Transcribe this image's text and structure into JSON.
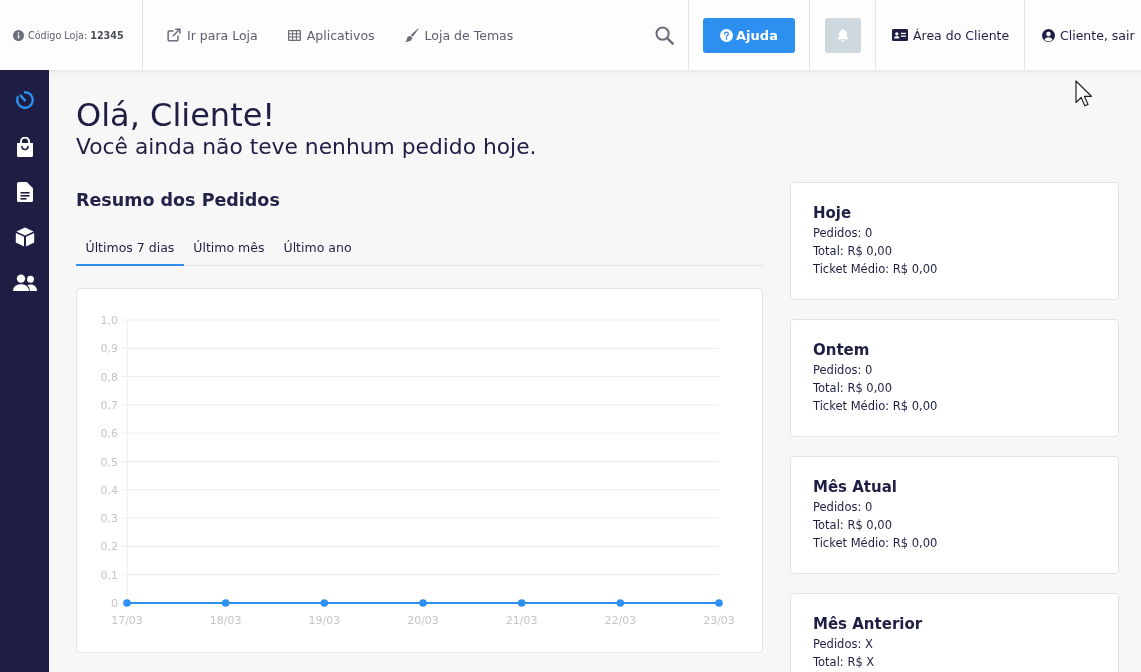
{
  "top_bar": {
    "store_code": "Código Loja: **12345**",
    "links": [
      {
        "label": "Ir para Loja"
      },
      {
        "label": "Aplicativos"
      },
      {
        "label": "Loja de Temas"
      }
    ],
    "help_button": "Ajuda",
    "client_area": "Área do Cliente",
    "logout": "Cliente, sair"
  },
  "sidebar": {
    "items": [
      {
        "selected": true
      },
      {
        "selected": false
      },
      {
        "selected": false
      },
      {
        "selected": false
      },
      {
        "selected": false
      }
    ]
  },
  "greeting": {
    "title": "Olá, Cliente!",
    "subtitle": "Você ainda não teve nenhum pedido hoje."
  },
  "orders_summary": {
    "title": "Resumo dos Pedidos",
    "tabs": [
      {
        "label": "Últimos 7 dias",
        "selected": true
      },
      {
        "label": "Último mês",
        "selected": false
      },
      {
        "label": "Último ano",
        "selected": false
      }
    ],
    "chart_data": {
      "type": "line",
      "grid": true,
      "categories": [
        "17/03",
        "18/03",
        "19/03",
        "20/03",
        "21/03",
        "22/03",
        "23/03"
      ],
      "series": [
        {
          "color": "#2d8ff0",
          "marker": true,
          "values": [
            0,
            0,
            0,
            0,
            0,
            0,
            0
          ]
        }
      ],
      "ylim": [
        0,
        1
      ],
      "yticks": [
        {
          "value": 0,
          "label": "0"
        },
        {
          "value": 0.1,
          "label": "0,1"
        },
        {
          "value": 0.2,
          "label": "0,2"
        },
        {
          "value": 0.3,
          "label": "0,3"
        },
        {
          "value": 0.4,
          "label": "0,4"
        },
        {
          "value": 0.5,
          "label": "0,5"
        },
        {
          "value": 0.6,
          "label": "0,6"
        },
        {
          "value": 0.7,
          "label": "0,7"
        },
        {
          "value": 0.8,
          "label": "0,8"
        },
        {
          "value": 0.9,
          "label": "0,9"
        },
        {
          "value": 1,
          "label": "1,0"
        }
      ]
    }
  },
  "period_cards": [
    {
      "title": "Hoje",
      "lines": [
        "Pedidos: 0",
        "Total: R$ 0,00",
        "Ticket Médio: R$ 0,00"
      ]
    },
    {
      "title": "Ontem",
      "lines": [
        "Pedidos: 0",
        "Total: R$ 0,00",
        "Ticket Médio: R$ 0,00"
      ]
    },
    {
      "title": "Mês Atual",
      "lines": [
        "Pedidos: 0",
        "Total: R$ 0,00",
        "Ticket Médio: R$ 0,00"
      ]
    },
    {
      "title": "Mês Anterior",
      "lines": [
        "Pedidos: X",
        "Total: R$ X"
      ]
    }
  ]
}
